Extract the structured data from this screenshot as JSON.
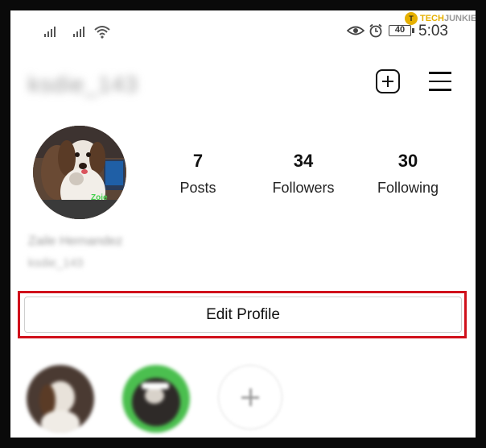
{
  "watermark": {
    "logo_letter": "T",
    "tech": "TECH",
    "junkie": "JUNKIE"
  },
  "status_bar": {
    "time": "5:03",
    "battery": "40"
  },
  "header": {
    "username": "ksdie_143",
    "icons": [
      "add-post-icon",
      "menu-icon"
    ]
  },
  "profile": {
    "avatar_caption": "Zoie",
    "stats": [
      {
        "value": "7",
        "label": "Posts"
      },
      {
        "value": "34",
        "label": "Followers"
      },
      {
        "value": "30",
        "label": "Following"
      }
    ],
    "full_name": "Zaile Hernandez",
    "bio": "ksdie_143"
  },
  "edit_profile": {
    "label": "Edit Profile"
  },
  "colors": {
    "highlight_border": "#d0101b",
    "caption_green": "#43d04c"
  }
}
